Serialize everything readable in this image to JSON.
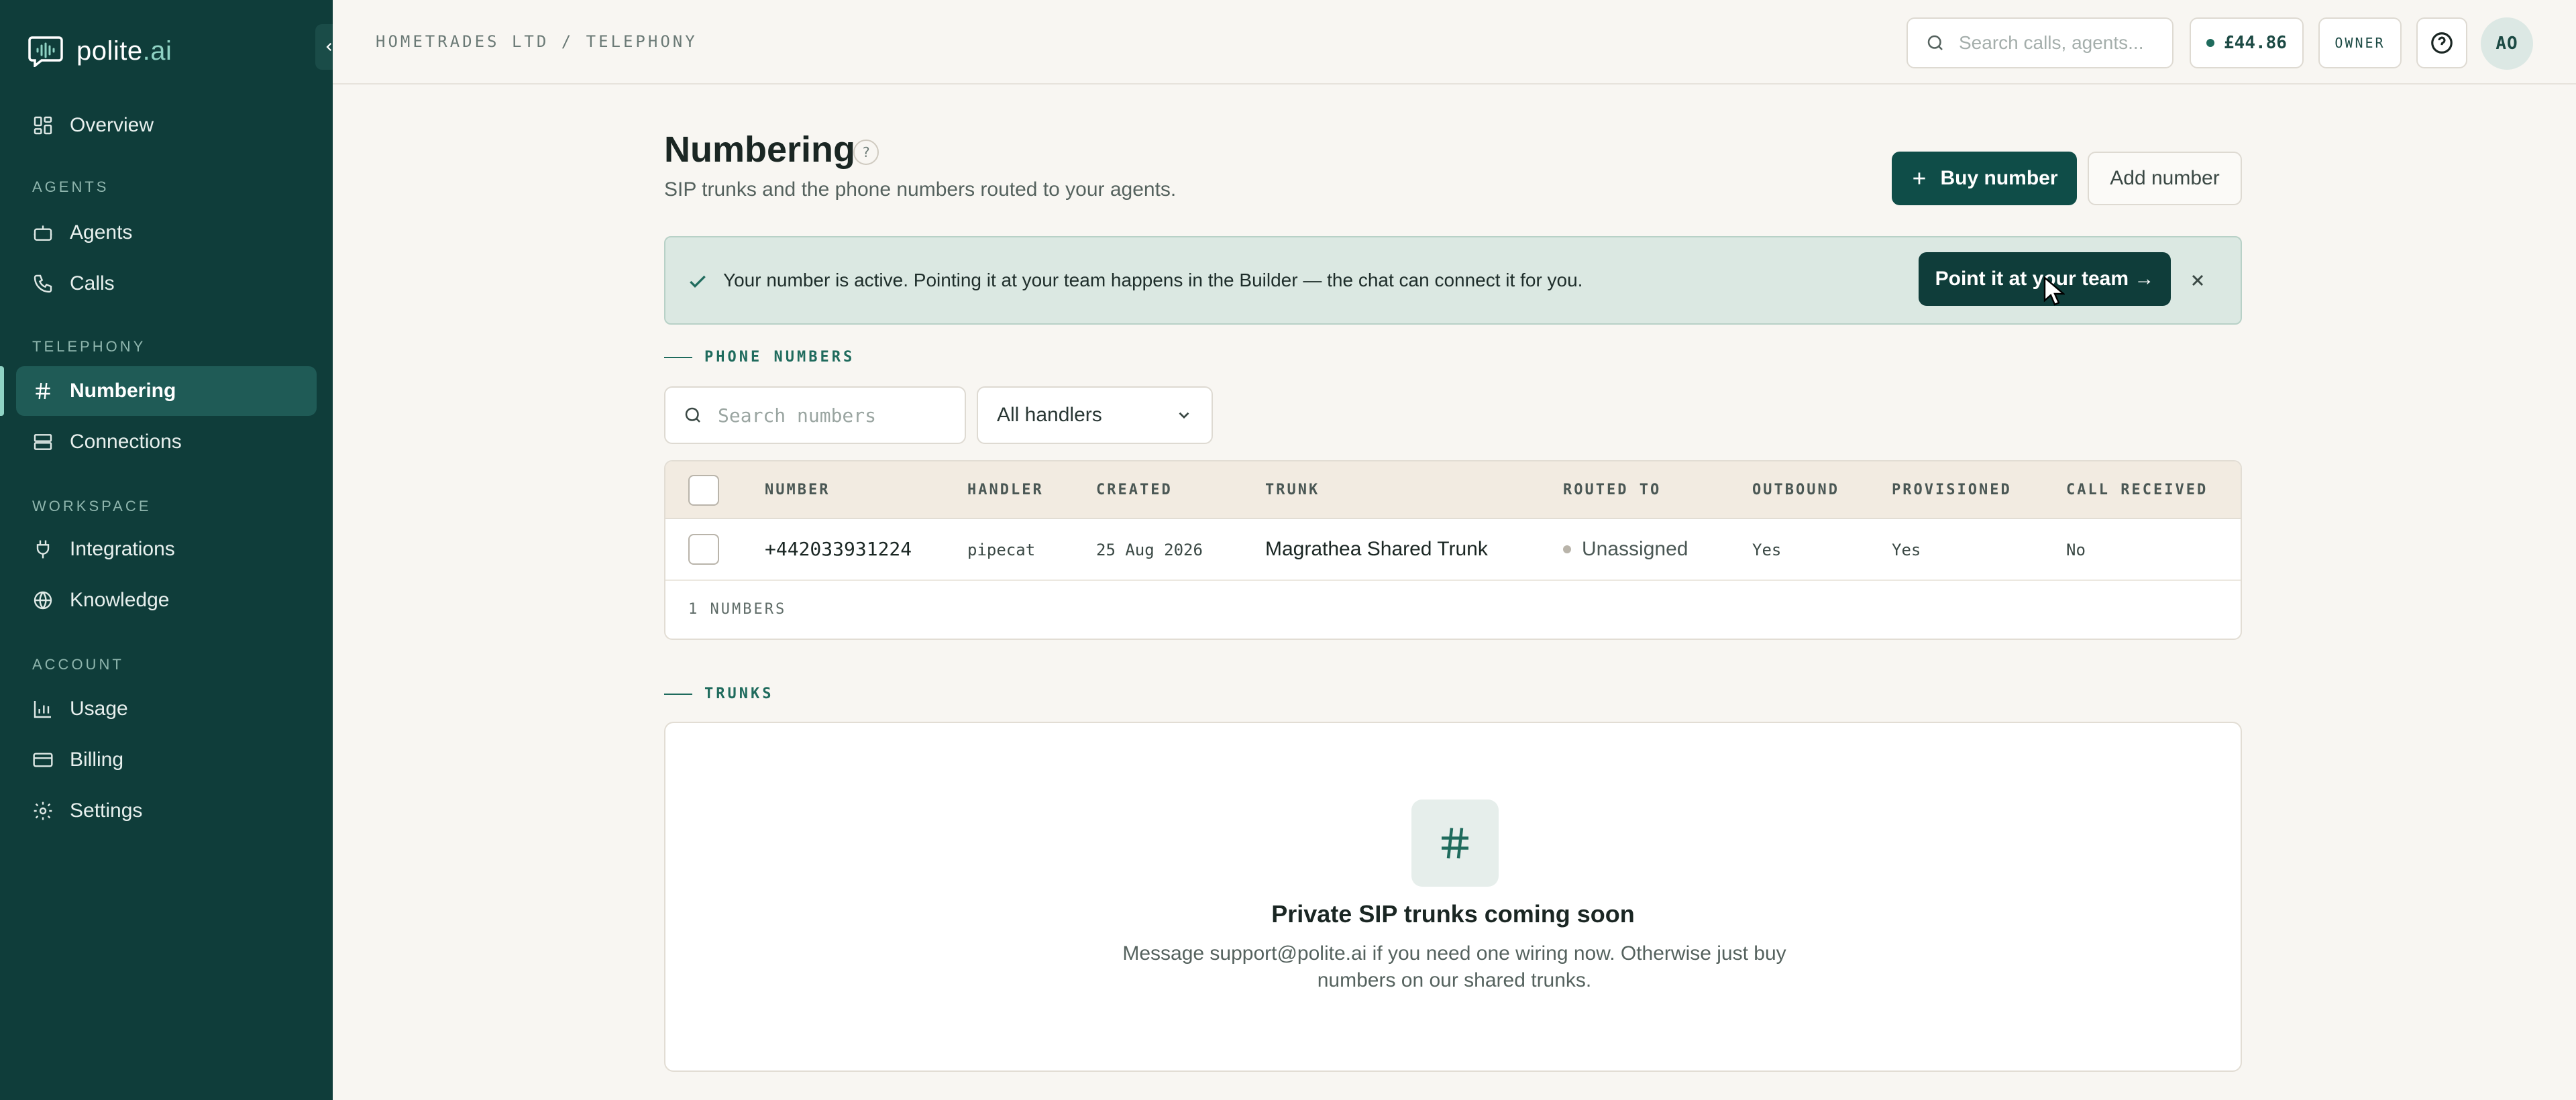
{
  "brand": {
    "name": "polite",
    "suffix": ".ai"
  },
  "sidebar": {
    "items": [
      {
        "label": "Overview",
        "icon": "grid-icon"
      },
      {
        "section": "AGENTS"
      },
      {
        "label": "Agents",
        "icon": "bot-icon"
      },
      {
        "label": "Calls",
        "icon": "phone-icon"
      },
      {
        "section": "TELEPHONY"
      },
      {
        "label": "Numbering",
        "icon": "hash-icon",
        "active": true
      },
      {
        "label": "Connections",
        "icon": "server-icon"
      },
      {
        "section": "WORKSPACE"
      },
      {
        "label": "Integrations",
        "icon": "plug-icon"
      },
      {
        "label": "Knowledge",
        "icon": "globe-icon"
      },
      {
        "section": "ACCOUNT"
      },
      {
        "label": "Usage",
        "icon": "bar-chart-icon"
      },
      {
        "label": "Billing",
        "icon": "credit-card-icon"
      },
      {
        "label": "Settings",
        "icon": "gear-icon"
      }
    ]
  },
  "topbar": {
    "breadcrumb": "HOMETRADES LTD / TELEPHONY",
    "search_placeholder": "Search calls, agents...",
    "balance": "£44.86",
    "role": "OWNER",
    "avatar_initials": "AO"
  },
  "page": {
    "title": "Numbering",
    "help_glyph": "?",
    "subtitle": "SIP trunks and the phone numbers routed to your agents.",
    "buy_label": "Buy number",
    "add_label": "Add number"
  },
  "banner": {
    "text": "Your number is active. Pointing it at your team happens in the Builder — the chat can connect it for you.",
    "cta": "Point it at your team →"
  },
  "phone_numbers": {
    "section_label": "PHONE NUMBERS",
    "search_placeholder": "Search numbers",
    "filter_value": "All handlers",
    "columns": [
      "NUMBER",
      "HANDLER",
      "CREATED",
      "TRUNK",
      "ROUTED TO",
      "OUTBOUND",
      "PROVISIONED",
      "CALL RECEIVED"
    ],
    "rows": [
      {
        "number": "+442033931224",
        "handler": "pipecat",
        "created": "25 Aug 2026",
        "trunk": "Magrathea Shared Trunk",
        "routed_to": "Unassigned",
        "outbound": "Yes",
        "provisioned": "Yes",
        "call_received": "No"
      }
    ],
    "footer": "1 NUMBERS"
  },
  "trunks": {
    "section_label": "TRUNKS",
    "empty_title": "Private SIP trunks coming soon",
    "empty_desc": "Message support@polite.ai if you need one wiring now. Otherwise just buy numbers on our shared trunks."
  },
  "colors": {
    "sidebar_bg": "#0f3d3a",
    "accent": "#1f6b5d",
    "primary_button": "#0f4d48",
    "banner_bg": "#dbe8e2",
    "page_bg": "#f8f6f2"
  }
}
